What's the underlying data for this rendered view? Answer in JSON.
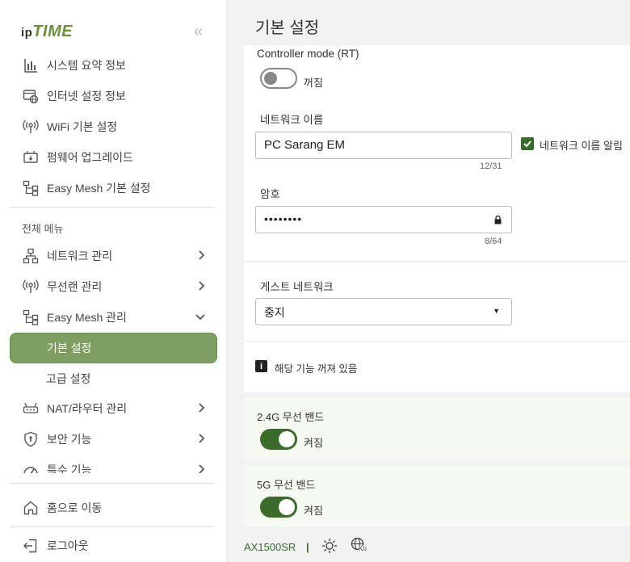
{
  "brand": {
    "ip": "ip",
    "time": "TIME",
    "collapse_glyph": "«"
  },
  "sidebar": {
    "top_items": [
      {
        "label": "시스템 요약 정보",
        "icon": "bar-chart-icon"
      },
      {
        "label": "인터넷 설정 정보",
        "icon": "internet-settings-icon"
      },
      {
        "label": "WiFi 기본 설정",
        "icon": "wifi-icon"
      },
      {
        "label": "펌웨어 업그레이드",
        "icon": "firmware-icon"
      },
      {
        "label": "Easy Mesh 기본 설정",
        "icon": "mesh-icon"
      }
    ],
    "section_label": "전체 메뉴",
    "menu_items": [
      {
        "label": "네트워크 관리",
        "icon": "network-icon",
        "chevron": "›"
      },
      {
        "label": "무선랜 관리",
        "icon": "wifi-icon",
        "chevron": "›"
      },
      {
        "label": "Easy Mesh 관리",
        "icon": "mesh-icon",
        "chevron": "⌄"
      },
      {
        "label": "기본 설정",
        "active": true
      },
      {
        "label": "고급 설정"
      },
      {
        "label": "NAT/라우터 관리",
        "icon": "router-icon",
        "chevron": "›"
      },
      {
        "label": "보안 기능",
        "icon": "shield-icon",
        "chevron": "›"
      },
      {
        "label": "특수 기능",
        "icon": "gauge-icon",
        "chevron": "›"
      }
    ],
    "bottom_items": [
      {
        "label": "홈으로 이동",
        "icon": "home-icon"
      },
      {
        "label": "로그아웃",
        "icon": "logout-icon"
      }
    ]
  },
  "header": {
    "title": "기본 설정"
  },
  "controller": {
    "label": "Controller mode (RT)",
    "state_text": "꺼짐"
  },
  "network_name": {
    "label": "네트워크 이름",
    "value": "PC Sarang EM",
    "count": "12/31",
    "broadcast_label": "네트워크 이름 알림"
  },
  "password": {
    "label": "암호",
    "value": "••••••••",
    "count": "8/64"
  },
  "guest": {
    "label": "게스트 네트워크",
    "selected": "중지",
    "arrow": "▼"
  },
  "notice": {
    "text": "해당 기능 꺼져 있음",
    "icon_char": "i"
  },
  "band24": {
    "label": "2.4G 무선 밴드",
    "state_text": "켜짐"
  },
  "band5": {
    "label": "5G 무선 밴드",
    "state_text": "켜짐"
  },
  "footer": {
    "model": "AX1500SR",
    "separator": "|",
    "lang_code": "Ko"
  },
  "colors": {
    "accent": "#7f9e61",
    "toggle_on": "#3b6b2a",
    "brand_green": "#6b8f3a"
  }
}
